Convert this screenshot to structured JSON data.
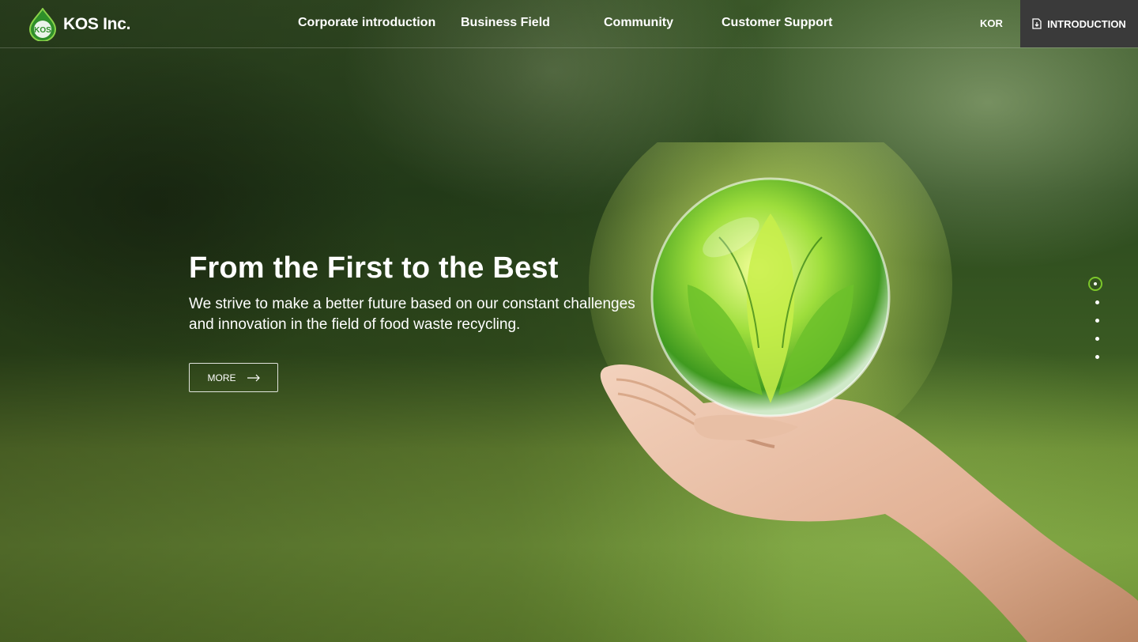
{
  "header": {
    "logo_mark_text": "KOS",
    "logo_text": "KOS Inc.",
    "nav": [
      {
        "label": "Corporate introduction"
      },
      {
        "label": "Business Field"
      },
      {
        "label": "Community"
      },
      {
        "label": "Customer Support"
      }
    ],
    "language": "KOR",
    "introduction_label": "INTRODUCTION"
  },
  "hero": {
    "title": "From the First to the Best",
    "subtitle_line1": "We strive to make a better future based on our constant challenges",
    "subtitle_line2": "and innovation in the field of food waste recycling.",
    "more_label": "MORE"
  },
  "slider": {
    "count": 5,
    "active_index": 0
  },
  "colors": {
    "accent": "#7cc62a",
    "introduction_bg": "#3a3a3a"
  }
}
